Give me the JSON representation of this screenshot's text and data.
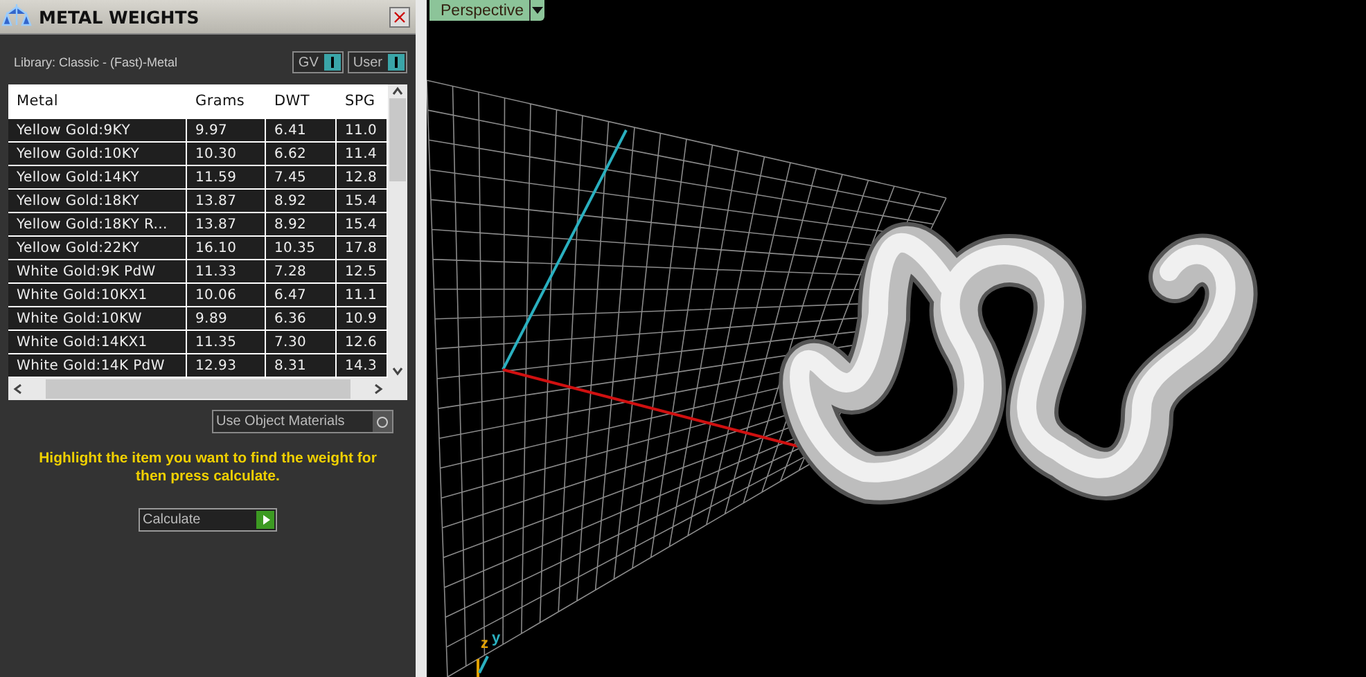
{
  "panel": {
    "title": "METAL WEIGHTS",
    "library": "Library: Classic - (Fast)-Metal",
    "toggles": [
      {
        "label": "GV",
        "on": true
      },
      {
        "label": "User",
        "on": true
      }
    ],
    "table": {
      "columns": [
        "Metal",
        "Grams",
        "DWT",
        "SPG"
      ],
      "rows": [
        [
          "Yellow Gold:9KY",
          "9.97",
          "6.41",
          "11.0"
        ],
        [
          "Yellow Gold:10KY",
          "10.30",
          "6.62",
          "11.4"
        ],
        [
          "Yellow Gold:14KY",
          "11.59",
          "7.45",
          "12.8"
        ],
        [
          "Yellow Gold:18KY",
          "13.87",
          "8.92",
          "15.4"
        ],
        [
          "Yellow Gold:18KY R...",
          "13.87",
          "8.92",
          "15.4"
        ],
        [
          "Yellow Gold:22KY",
          "16.10",
          "10.35",
          "17.8"
        ],
        [
          "White Gold:9K PdW",
          "11.33",
          "7.28",
          "12.5"
        ],
        [
          "White Gold:10KX1",
          "10.06",
          "6.47",
          "11.1"
        ],
        [
          "White Gold:10KW",
          "9.89",
          "6.36",
          "10.9"
        ],
        [
          "White Gold:14KX1",
          "11.35",
          "7.30",
          "12.6"
        ],
        [
          "White Gold:14K PdW",
          "12.93",
          "8.31",
          "14.3"
        ]
      ]
    },
    "use_object_materials": {
      "label": "Use Object Materials",
      "checked": false
    },
    "hint": "Highlight the item you want to find the weight for then press calculate.",
    "calculate": "Calculate"
  },
  "viewport": {
    "view": "Perspective",
    "gizmo": [
      "z",
      "y"
    ]
  }
}
